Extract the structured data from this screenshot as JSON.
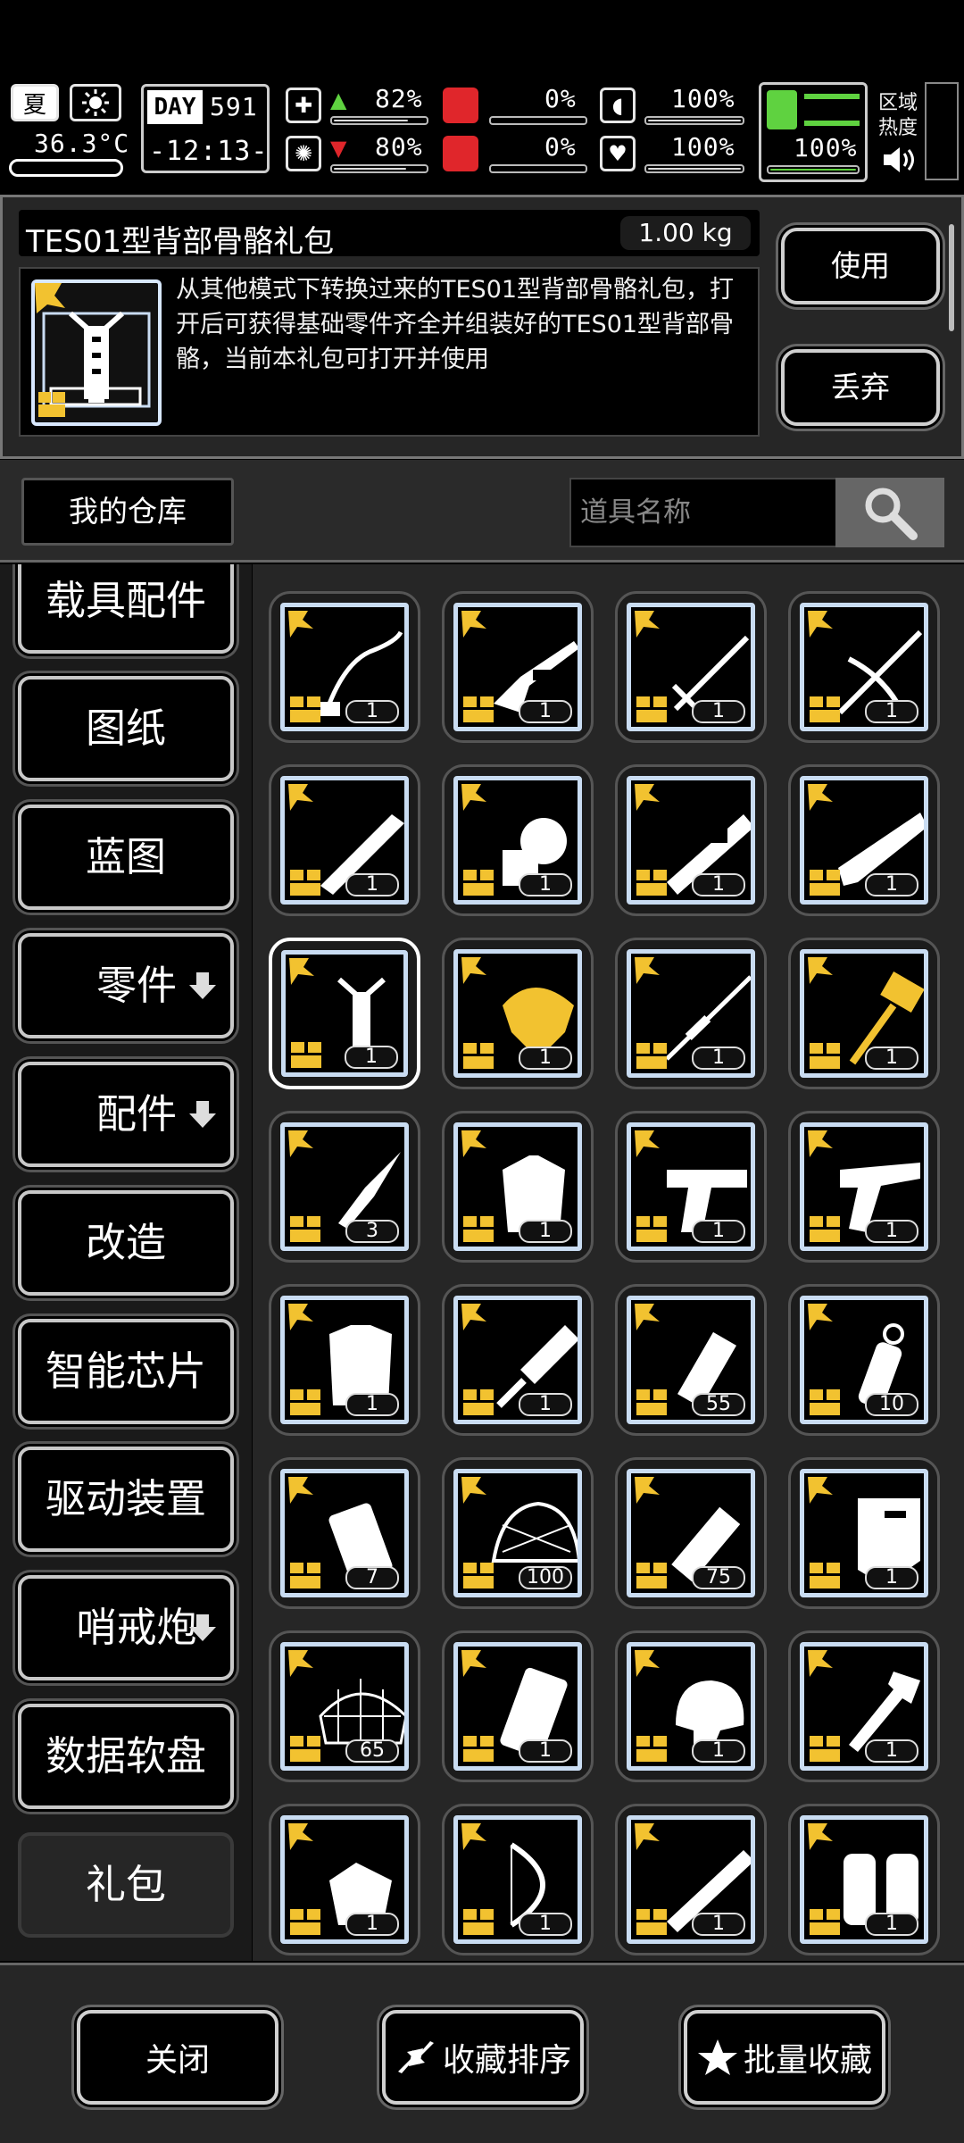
{
  "status": {
    "season": "夏",
    "temperature": "36.3°C",
    "day_label": "DAY",
    "day_number": "591",
    "clock": "-12:13-",
    "health": "82%",
    "mental": "80%",
    "hunger": "0%",
    "bleed": "0%",
    "armor": "100%",
    "heart": "100%",
    "stamina": "100%",
    "zone_label": "区域\n热度",
    "levels": {
      "health": 0.82,
      "mental": 0.8,
      "hunger": 0.0,
      "bleed": 0.0,
      "armor": 1.0,
      "heart": 1.0,
      "stamina": 1.0
    }
  },
  "item": {
    "name": "TES01型背部骨骼礼包",
    "weight": "1.00 kg",
    "description": "从其他模式下转换过来的TES01型背部骨骼礼包，打开后可获得基础零件齐全并组装好的TES01型背部骨骼，当前本礼包可打开并使用",
    "use_label": "使用",
    "discard_label": "丢弃"
  },
  "search": {
    "warehouse_label": "我的仓库",
    "placeholder": "道具名称"
  },
  "categories": [
    {
      "label": "载具配件"
    },
    {
      "label": "图纸"
    },
    {
      "label": "蓝图"
    },
    {
      "label": "零件"
    },
    {
      "label": "配件"
    },
    {
      "label": "改造"
    },
    {
      "label": "智能芯片"
    },
    {
      "label": "驱动装置"
    },
    {
      "label": "哨戒炮"
    },
    {
      "label": "数据软盘"
    },
    {
      "label": "礼包"
    }
  ],
  "grid": [
    [
      {
        "icon": "whip-icon",
        "count": "1"
      },
      {
        "icon": "rifle-icon",
        "count": "1"
      },
      {
        "icon": "sword-icon",
        "count": "1"
      },
      {
        "icon": "crossbow-icon",
        "count": "1"
      }
    ],
    [
      {
        "icon": "chainsword-icon",
        "count": "1"
      },
      {
        "icon": "flamethrower-icon",
        "count": "1"
      },
      {
        "icon": "launcher-icon",
        "count": "1"
      },
      {
        "icon": "heavy-gun-icon",
        "count": "1"
      }
    ],
    [
      {
        "icon": "back-skeleton-icon",
        "count": "1"
      },
      {
        "icon": "golden-armor-icon",
        "count": "1"
      },
      {
        "icon": "sniper-icon",
        "count": "1"
      },
      {
        "icon": "hammer-icon",
        "count": "1"
      }
    ],
    [
      {
        "icon": "kunai-icon",
        "count": "3"
      },
      {
        "icon": "fur-coat-icon",
        "count": "1"
      },
      {
        "icon": "pistol-icon",
        "count": "1"
      },
      {
        "icon": "revolver-icon",
        "count": "1"
      }
    ],
    [
      {
        "icon": "vest-icon",
        "count": "1"
      },
      {
        "icon": "cleaver-icon",
        "count": "1"
      },
      {
        "icon": "flashbang-icon",
        "count": "55"
      },
      {
        "icon": "grenade-icon",
        "count": "10"
      }
    ],
    [
      {
        "icon": "incendiary-icon",
        "count": "7"
      },
      {
        "icon": "camo-helmet-icon",
        "count": "100"
      },
      {
        "icon": "smoke-grenade-icon",
        "count": "75"
      },
      {
        "icon": "riot-shield-icon",
        "count": "1"
      }
    ],
    [
      {
        "icon": "net-icon",
        "count": "65"
      },
      {
        "icon": "plate-icon",
        "count": "1"
      },
      {
        "icon": "tactical-helmet-icon",
        "count": "1"
      },
      {
        "icon": "shovel-icon",
        "count": "1"
      }
    ],
    [
      {
        "icon": "gloves-icon",
        "count": "1"
      },
      {
        "icon": "bow-icon",
        "count": "1"
      },
      {
        "icon": "shotgun-icon",
        "count": "1"
      },
      {
        "icon": "gauntlets-icon",
        "count": "1"
      }
    ]
  ],
  "bottom": {
    "close_label": "关闭",
    "sort_label": "收藏排序",
    "batch_label": "批量收藏"
  },
  "colors": {
    "accent_gold": "#f2c230",
    "frame_blue": "#c9dcf2",
    "green": "#5fd240",
    "red": "#e0262b"
  }
}
